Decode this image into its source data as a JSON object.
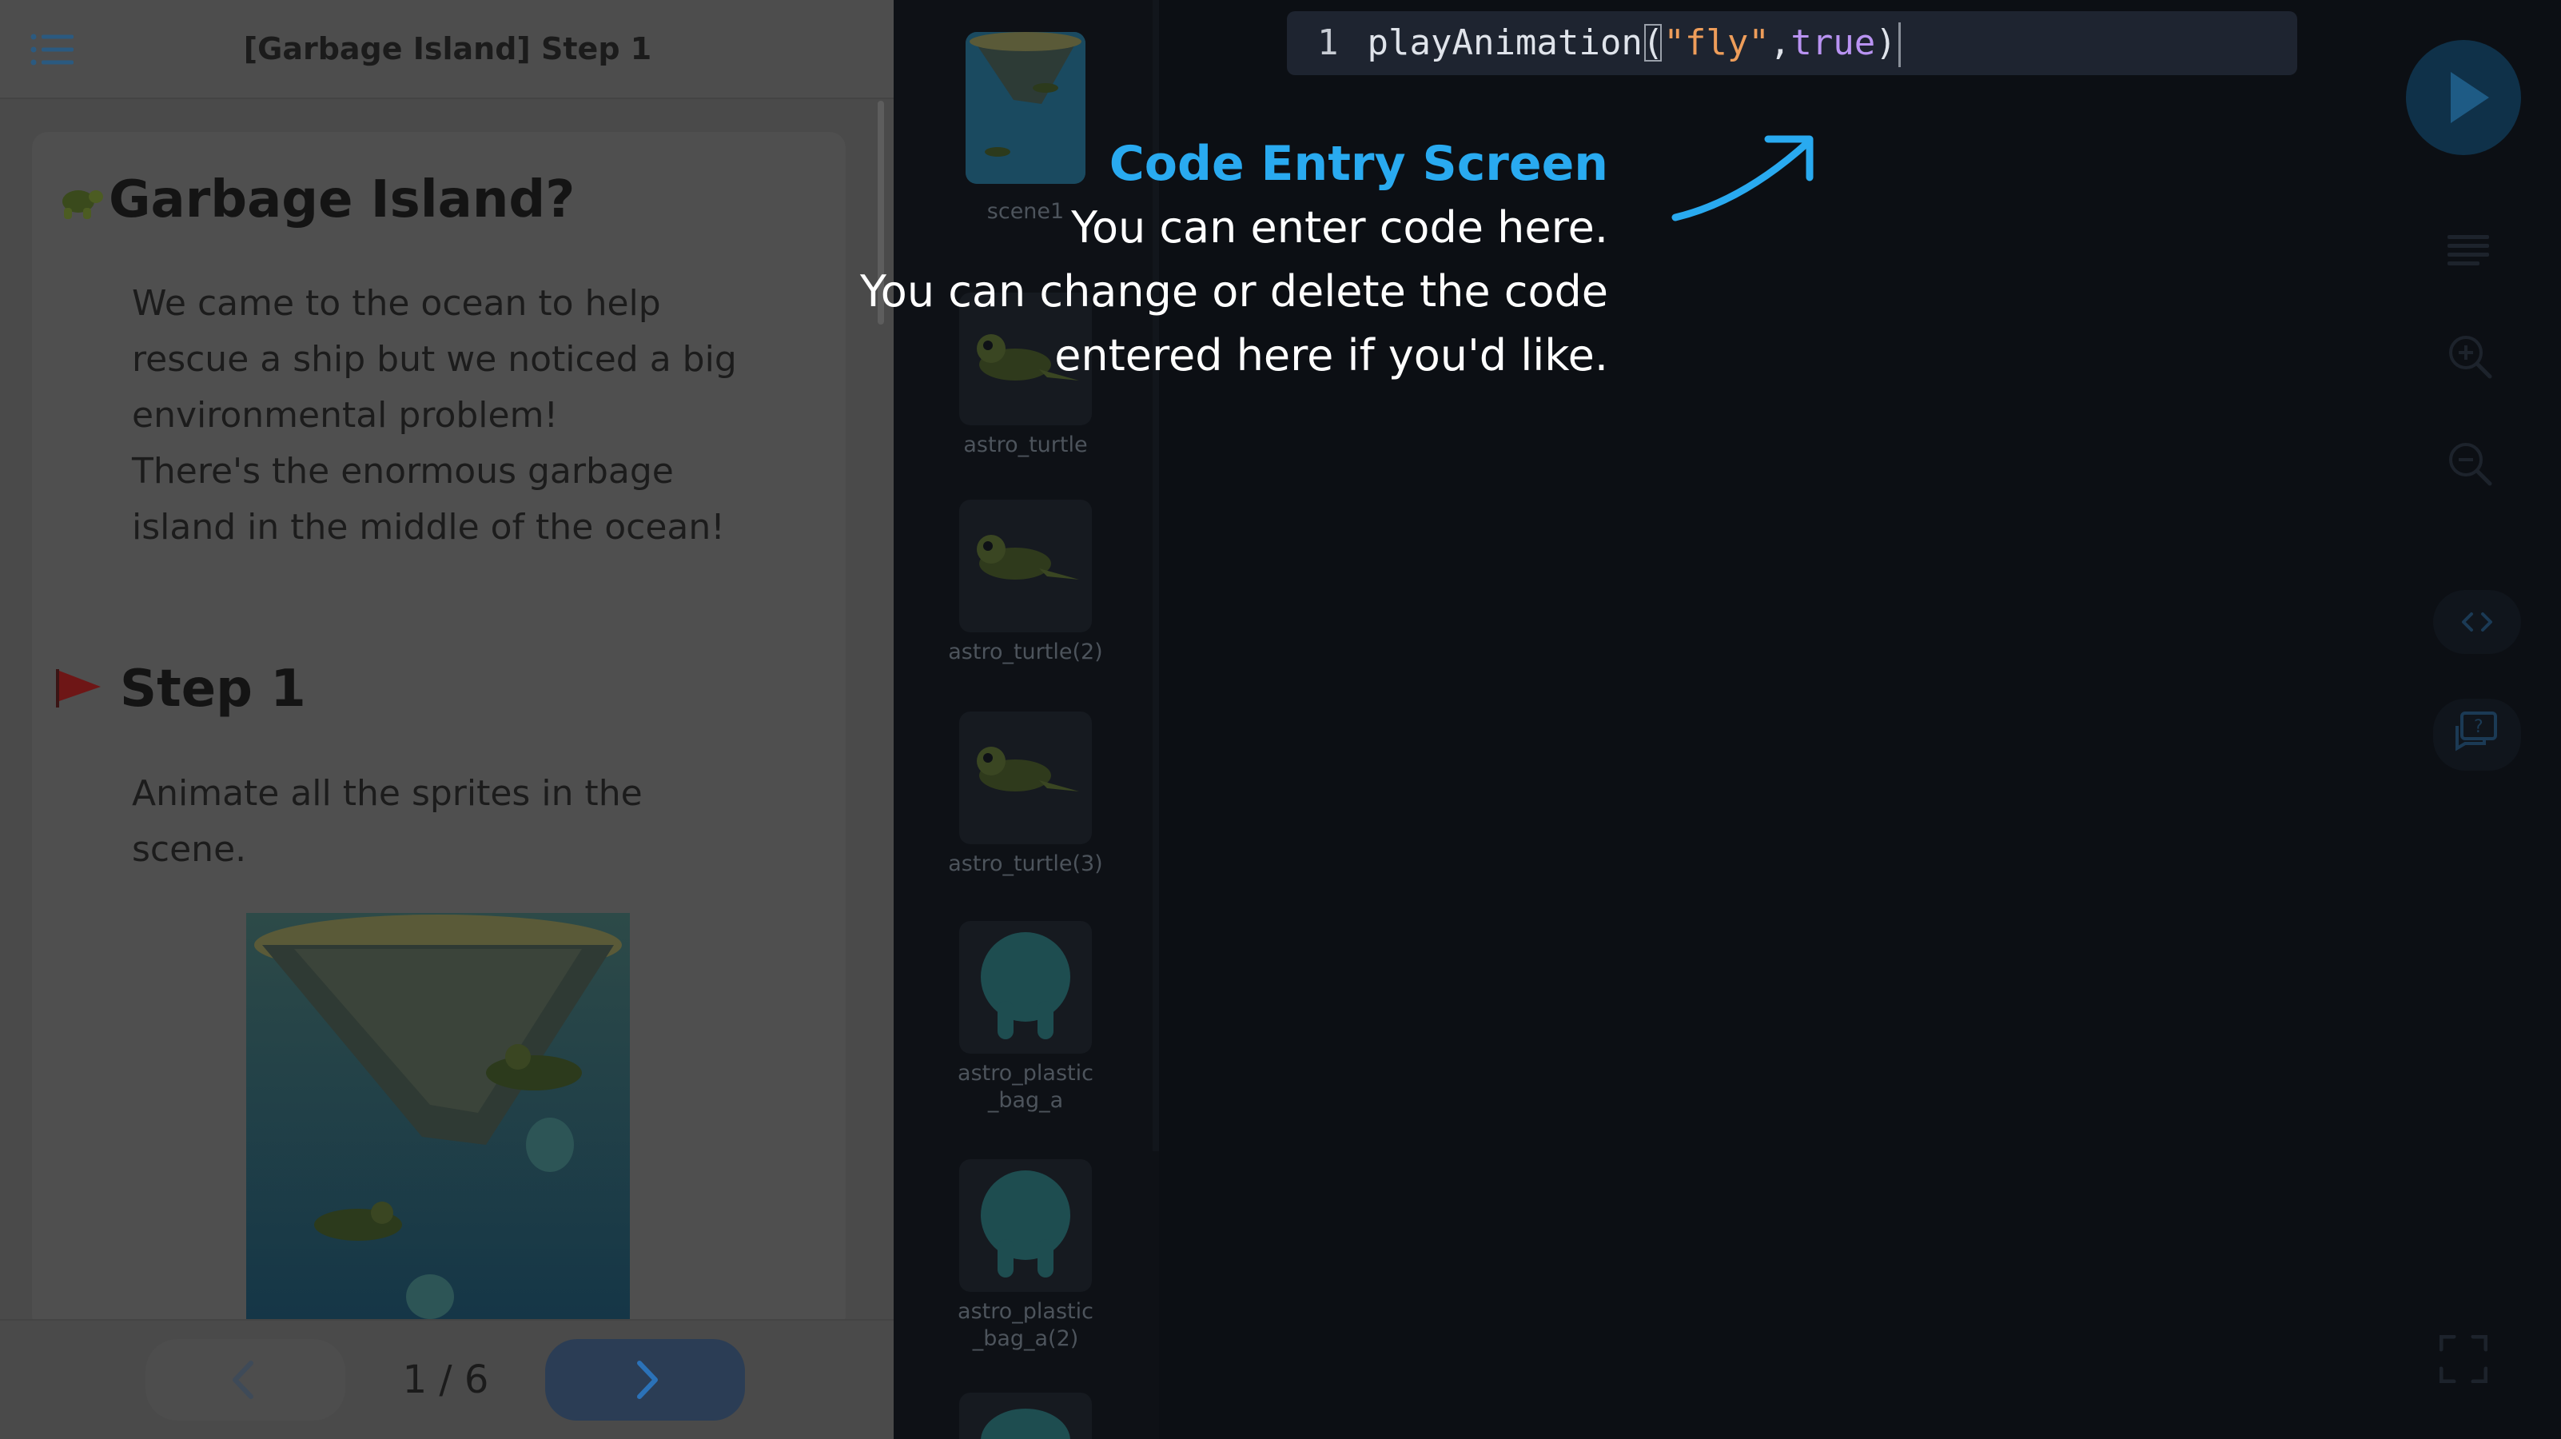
{
  "tutorial": {
    "title": "[Garbage Island] Step 1",
    "heading": "Garbage Island?",
    "intro_lines": [
      "We came to the ocean to help",
      "rescue a ship but we noticed a big",
      "environmental problem!",
      "There's the enormous garbage",
      "island in the middle of the ocean!"
    ],
    "step_heading": "Step 1",
    "step_lines": [
      "Animate all the sprites in the",
      "scene."
    ],
    "page_current": "1",
    "page_separator": "/",
    "page_total": "6"
  },
  "sprites": [
    {
      "name": "scene1"
    },
    {
      "name": "astro_turtle"
    },
    {
      "name": "astro_turtle(2)"
    },
    {
      "name": "astro_turtle(3)"
    },
    {
      "name": "astro_plastic_bag_a"
    },
    {
      "name": "astro_plastic_bag_a(2)"
    }
  ],
  "editor": {
    "line_number": "1",
    "code_fn": "playAnimation",
    "code_open": "(",
    "code_str": "\"fly\"",
    "code_comma": ",",
    "code_kw": "true",
    "code_close": ")"
  },
  "callout": {
    "title": "Code Entry Screen",
    "lines": [
      "You can enter code here.",
      "You can change or delete the code",
      "entered here if you'd like."
    ]
  },
  "toolbar": {
    "icons": [
      "play-icon",
      "list-icon",
      "zoom-in-icon",
      "zoom-out-icon",
      "code-toggle-icon",
      "help-chat-icon",
      "fullscreen-icon"
    ]
  },
  "colors": {
    "accent_blue": "#29aaf0",
    "code_string": "#ee9d5a",
    "code_keyword": "#b993f2"
  }
}
